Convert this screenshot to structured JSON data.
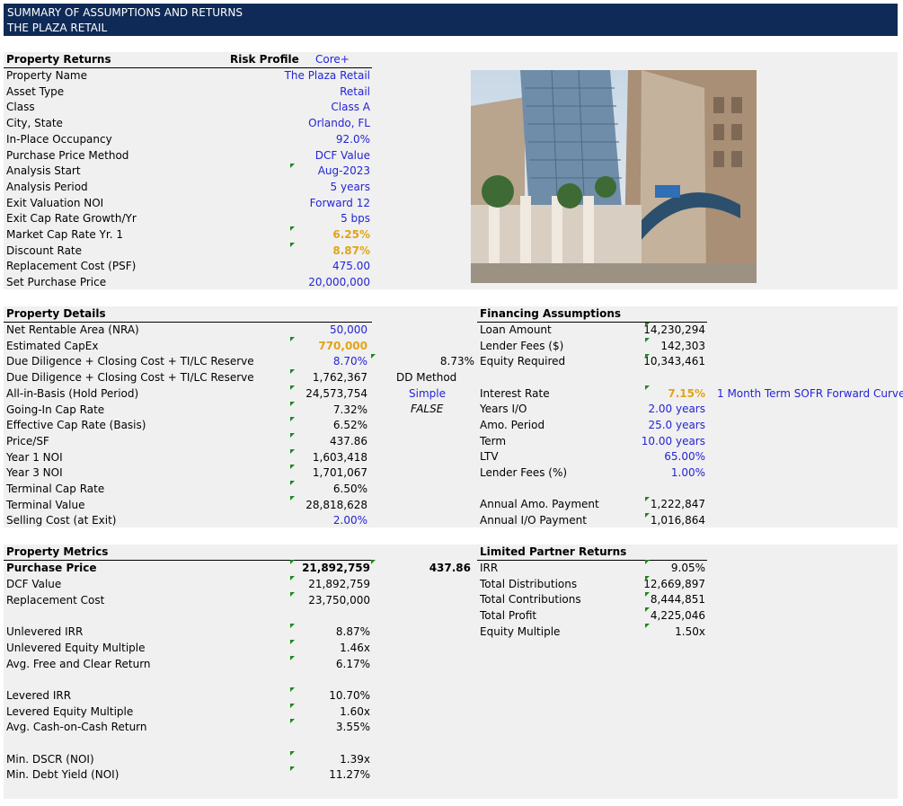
{
  "banner": {
    "line1": "SUMMARY OF ASSUMPTIONS AND RETURNS",
    "line2": "THE PLAZA RETAIL"
  },
  "property_returns": {
    "header": "Property Returns",
    "risk_label": "Risk Profile",
    "risk_value": "Core+",
    "rows": [
      {
        "label": "Property Name",
        "value": "The Plaza Retail"
      },
      {
        "label": "Asset Type",
        "value": "Retail"
      },
      {
        "label": "Class",
        "value": "Class A"
      },
      {
        "label": "City, State",
        "value": "Orlando, FL"
      },
      {
        "label": "In-Place Occupancy",
        "value": "92.0%"
      },
      {
        "label": "Purchase Price Method",
        "value": "DCF Value"
      },
      {
        "label": "Analysis Start",
        "value": "Aug-2023"
      },
      {
        "label": "Analysis Period",
        "value": "5 years"
      },
      {
        "label": "Exit Valuation NOI",
        "value": "Forward 12"
      },
      {
        "label": "Exit Cap Rate Growth/Yr",
        "value": "5 bps"
      },
      {
        "label": "Market Cap Rate Yr. 1",
        "value": "6.25%"
      },
      {
        "label": "Discount Rate",
        "value": "8.87%"
      },
      {
        "label": "Replacement Cost (PSF)",
        "value": "475.00"
      },
      {
        "label": "Set Purchase Price",
        "value": "20,000,000"
      }
    ]
  },
  "property_details": {
    "header": "Property Details",
    "rows": [
      {
        "label": "Net Rentable Area (NRA)",
        "value": "50,000"
      },
      {
        "label": "Estimated CapEx",
        "value": "770,000"
      },
      {
        "label": "Due Diligence + Closing Cost + TI/LC Reserve",
        "value": "8.70%"
      },
      {
        "label": "Due Diligence + Closing Cost + TI/LC Reserve",
        "value": "1,762,367"
      },
      {
        "label": "All-in-Basis (Hold Period)",
        "value": "24,573,754"
      },
      {
        "label": "Going-In Cap Rate",
        "value": "7.32%"
      },
      {
        "label": "Effective Cap Rate (Basis)",
        "value": "6.52%"
      },
      {
        "label": "Price/SF",
        "value": "437.86"
      },
      {
        "label": "Year 1 NOI",
        "value": "1,603,418"
      },
      {
        "label": "Year 3 NOI",
        "value": "1,701,067"
      },
      {
        "label": "Terminal Cap Rate",
        "value": "6.50%"
      },
      {
        "label": "Terminal Value",
        "value": "28,818,628"
      },
      {
        "label": "Selling Cost (at Exit)",
        "value": "2.00%"
      }
    ],
    "extra_pct": "8.73%",
    "dd_method_label": "DD Method",
    "dd_method_value": "Simple",
    "dd_flag": "FALSE"
  },
  "financing": {
    "header": "Financing Assumptions",
    "rows": [
      {
        "label": "Loan Amount",
        "value": "14,230,294"
      },
      {
        "label": "Lender Fees ($)",
        "value": "142,303"
      },
      {
        "label": "Equity Required",
        "value": "10,343,461"
      },
      {
        "label": "Interest Rate",
        "value": "7.15%"
      },
      {
        "label": "Years I/O",
        "value": "2.00 years"
      },
      {
        "label": "Amo. Period",
        "value": "25.0 years"
      },
      {
        "label": "Term",
        "value": "10.00 years"
      },
      {
        "label": "LTV",
        "value": "65.00%"
      },
      {
        "label": "Lender Fees (%)",
        "value": "1.00%"
      },
      {
        "label": "Annual Amo. Payment",
        "value": "1,222,847"
      },
      {
        "label": "Annual I/O Payment",
        "value": "1,016,864"
      }
    ],
    "curve_note": "1 Month Term SOFR Forward Curve"
  },
  "property_metrics": {
    "header": "Property Metrics",
    "purchase_price_label": "Purchase Price",
    "purchase_price_value": "21,892,759",
    "purchase_psf": "437.86",
    "rows": [
      {
        "label": "DCF Value",
        "value": "21,892,759"
      },
      {
        "label": "Replacement Cost",
        "value": "23,750,000"
      },
      {
        "label": "Unlevered IRR",
        "value": "8.87%"
      },
      {
        "label": "Unlevered Equity Multiple",
        "value": "1.46x"
      },
      {
        "label": "Avg. Free and Clear Return",
        "value": "6.17%"
      },
      {
        "label": "Levered IRR",
        "value": "10.70%"
      },
      {
        "label": "Levered Equity Multiple",
        "value": "1.60x"
      },
      {
        "label": "Avg. Cash-on-Cash Return",
        "value": "3.55%"
      },
      {
        "label": "Min. DSCR (NOI)",
        "value": "1.39x"
      },
      {
        "label": "Min. Debt Yield (NOI)",
        "value": "11.27%"
      }
    ]
  },
  "lp_returns": {
    "header": "Limited Partner Returns",
    "rows": [
      {
        "label": "IRR",
        "value": "9.05%"
      },
      {
        "label": "Total Distributions",
        "value": "12,669,897"
      },
      {
        "label": "Total Contributions",
        "value": "8,444,851"
      },
      {
        "label": "Total Profit",
        "value": "4,225,046"
      },
      {
        "label": "Equity Multiple",
        "value": "1.50x"
      }
    ]
  },
  "colors": {
    "banner": "#0f2a57",
    "input_blue": "#2424d6",
    "highlight_gold": "#e0a418",
    "panel": "#f0f0f0",
    "comment_marker": "#1a8a1a"
  }
}
